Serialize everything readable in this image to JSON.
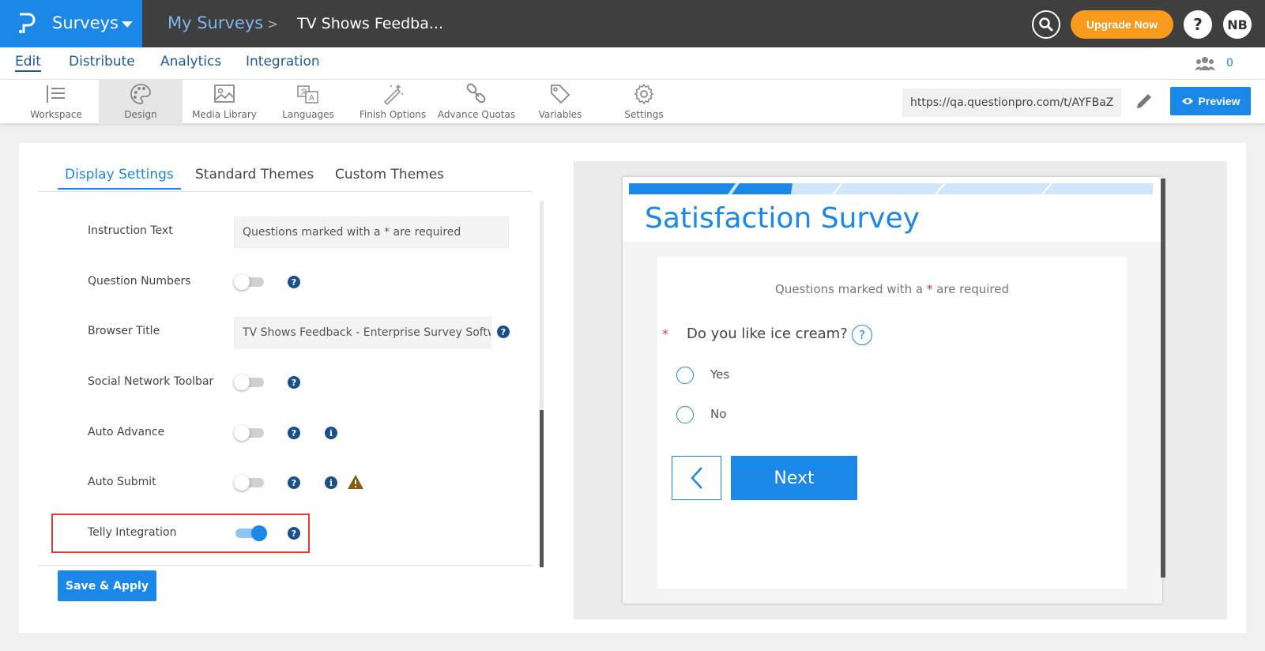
{
  "header": {
    "app_name": "Surveys",
    "breadcrumb_link": "My Surveys",
    "breadcrumb_sep": ">",
    "survey_name": "TV Shows Feedba...",
    "upgrade_label": "Upgrade Now",
    "help_label": "?",
    "avatar_initials": "NB",
    "brand_color": "#1b87e6",
    "upgrade_color": "#f89b1c"
  },
  "subnav": {
    "items": [
      {
        "label": "Edit"
      },
      {
        "label": "Distribute"
      },
      {
        "label": "Analytics"
      },
      {
        "label": "Integration"
      }
    ],
    "collaborator_count": "0"
  },
  "toolbar": {
    "tools": [
      {
        "label": "Workspace",
        "icon": "workspace-icon"
      },
      {
        "label": "Design",
        "icon": "palette-icon"
      },
      {
        "label": "Media Library",
        "icon": "image-icon"
      },
      {
        "label": "Languages",
        "icon": "translate-icon"
      },
      {
        "label": "Finish Options",
        "icon": "magic-wand-icon"
      },
      {
        "label": "Advance Quotas",
        "icon": "chain-link-icon"
      },
      {
        "label": "Variables",
        "icon": "tag-icon"
      },
      {
        "label": "Settings",
        "icon": "gear-icon"
      }
    ],
    "survey_url": "https://qa.questionpro.com/t/AYFBaZ",
    "preview_label": "Preview"
  },
  "settings": {
    "tabs": [
      {
        "label": "Display Settings"
      },
      {
        "label": "Standard Themes"
      },
      {
        "label": "Custom Themes"
      }
    ],
    "rows": [
      {
        "label": "Instruction Text",
        "value": "Questions marked with a * are required"
      },
      {
        "label": "Question Numbers",
        "enabled": false
      },
      {
        "label": "Browser Title",
        "value": "TV Shows Feedback - Enterprise Survey Software"
      },
      {
        "label": "Social Network Toolbar",
        "enabled": false
      },
      {
        "label": "Auto Advance",
        "enabled": false
      },
      {
        "label": "Auto Submit",
        "enabled": false
      },
      {
        "label": "Telly Integration",
        "enabled": true
      }
    ],
    "help_glyph": "?",
    "info_glyph": "i",
    "save_label": "Save & Apply"
  },
  "preview": {
    "title": "Satisfaction Survey",
    "required_note_before": "Questions marked with a ",
    "required_note_star": "*",
    "required_note_after": " are required",
    "question_star": "*",
    "question": "Do you like ice cream?",
    "question_help": "?",
    "options": [
      {
        "label": "Yes"
      },
      {
        "label": "No"
      }
    ],
    "next_label": "Next"
  }
}
